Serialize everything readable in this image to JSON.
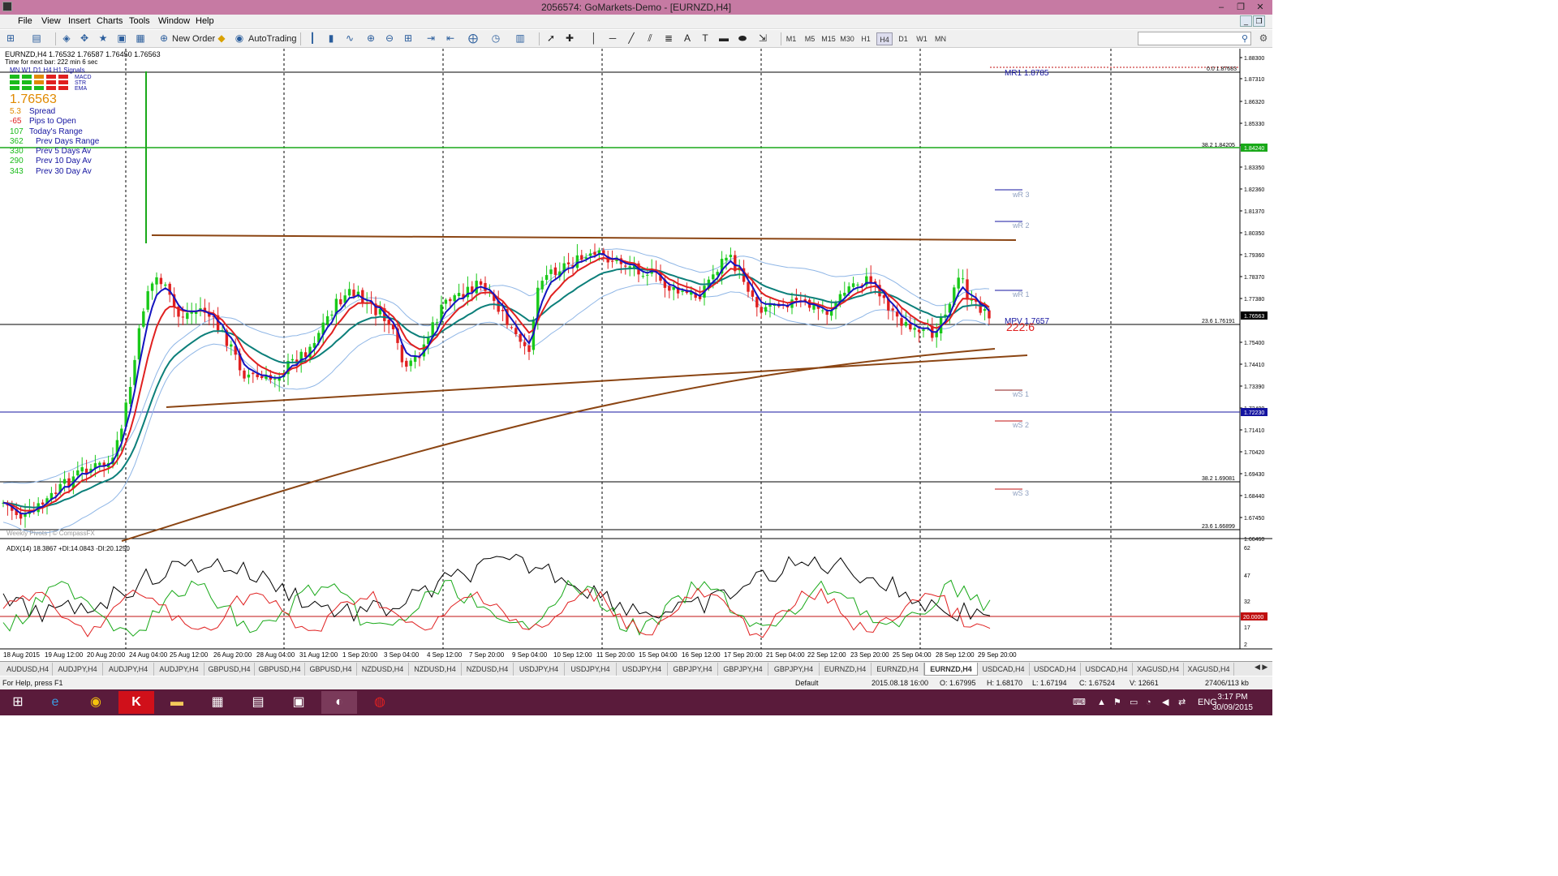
{
  "window": {
    "title": "2056574: GoMarkets-Demo - [EURNZD,H4]"
  },
  "menu": [
    "File",
    "View",
    "Insert",
    "Charts",
    "Tools",
    "Window",
    "Help"
  ],
  "toolbar": {
    "new_order": "New Order",
    "autotrading": "AutoTrading",
    "timeframes": [
      "M1",
      "M5",
      "M15",
      "M30",
      "H1",
      "H4",
      "D1",
      "W1",
      "MN"
    ],
    "active_timeframe": "H4"
  },
  "chart_header": {
    "symbol_line": "EURNZD,H4  1.76532 1.76587 1.76450 1.76563",
    "next_bar": "Time for next bar: 222 min 6 sec",
    "signal_tfs": "MN  W1  D1  H4  H1  Signals",
    "signal_rows": [
      "MACD",
      "STR",
      "EMA"
    ],
    "price": "1.76563",
    "stats": [
      {
        "value": "5.3",
        "label": "Spread",
        "color": "#e08a00"
      },
      {
        "value": "-65",
        "label": "Pips to Open",
        "color": "#e02020"
      },
      {
        "value": "107",
        "label": "Today's Range",
        "color": "#1bbb1b"
      },
      {
        "value": "362",
        "label": "Prev Days Range",
        "color": "#1bbb1b"
      },
      {
        "value": "330",
        "label": "Prev 5 Days Av",
        "color": "#1bbb1b"
      },
      {
        "value": "290",
        "label": "Prev 10 Day Av",
        "color": "#1bbb1b"
      },
      {
        "value": "343",
        "label": "Prev 30 Day Av",
        "color": "#1bbb1b"
      }
    ],
    "watermark": "Weekly Pivots | © CompassFX"
  },
  "annotations": {
    "mr1": "MR1  1.8785",
    "fib_top": "0.0 1.87683",
    "fib_382_top": "38.2 1.84205",
    "wr3": "wR 3",
    "wr2": "wR 2",
    "wr1": "wR 1",
    "mpv": "MPV  1.7657",
    "countdown": "222:6",
    "fib_236": "23.6 1.76191",
    "ws1": "wS 1",
    "ws2": "wS 2",
    "ws3": "wS 3",
    "fib_382_bot": "38.2 1.69081",
    "fib_236_bot": "23.6 1.66899"
  },
  "price_axis": [
    "1.88300",
    "1.87310",
    "1.86320",
    "1.85330",
    "1.84240",
    "1.83350",
    "1.82360",
    "1.81370",
    "1.80350",
    "1.79360",
    "1.78370",
    "1.77380",
    "1.76563",
    "1.75400",
    "1.74410",
    "1.73390",
    "1.72400",
    "1.72230",
    "1.71410",
    "1.70420",
    "1.69430",
    "1.68440",
    "1.67450",
    "1.66460"
  ],
  "price_tags": {
    "current": "1.76563",
    "green_line": "1.84240",
    "blue_line": "1.72230"
  },
  "adx": {
    "label": "ADX(14) 18.3867 +DI:14.0843 -DI:20.1250",
    "axis": [
      "62",
      "47",
      "32",
      "20.0000",
      "17",
      "2"
    ]
  },
  "time_axis": [
    "18 Aug 2015",
    "19 Aug 12:00",
    "20 Aug 20:00",
    "24 Aug 04:00",
    "25 Aug 12:00",
    "26 Aug 20:00",
    "28 Aug 04:00",
    "31 Aug 12:00",
    "1 Sep 20:00",
    "3 Sep 04:00",
    "4 Sep 12:00",
    "7 Sep 20:00",
    "9 Sep 04:00",
    "10 Sep 12:00",
    "11 Sep 20:00",
    "15 Sep 04:00",
    "16 Sep 12:00",
    "17 Sep 20:00",
    "21 Sep 04:00",
    "22 Sep 12:00",
    "23 Sep 20:00",
    "25 Sep 04:00",
    "28 Sep 12:00",
    "29 Sep 20:00"
  ],
  "tabs": [
    "AUDUSD,H4",
    "AUDJPY,H4",
    "AUDJPY,H4",
    "AUDJPY,H4",
    "GBPUSD,H4",
    "GBPUSD,H4",
    "GBPUSD,H4",
    "NZDUSD,H4",
    "NZDUSD,H4",
    "NZDUSD,H4",
    "USDJPY,H4",
    "USDJPY,H4",
    "USDJPY,H4",
    "GBPJPY,H4",
    "GBPJPY,H4",
    "GBPJPY,H4",
    "EURNZD,H4",
    "EURNZD,H4",
    "EURNZD,H4",
    "USDCAD,H4",
    "USDCAD,H4",
    "USDCAD,H4",
    "XAGUSD,H4",
    "XAGUSD,H4"
  ],
  "active_tab": 18,
  "status": {
    "help": "For Help, press F1",
    "profile": "Default",
    "time": "2015.08.18 16:00",
    "open": "O: 1.67995",
    "high": "H: 1.68170",
    "low": "L: 1.67194",
    "close": "C: 1.67524",
    "volume": "V: 12661",
    "traffic": "27406/113 kb"
  },
  "taskbar": {
    "lang": "ENG",
    "time": "3:17 PM",
    "date": "30/09/2015"
  }
}
